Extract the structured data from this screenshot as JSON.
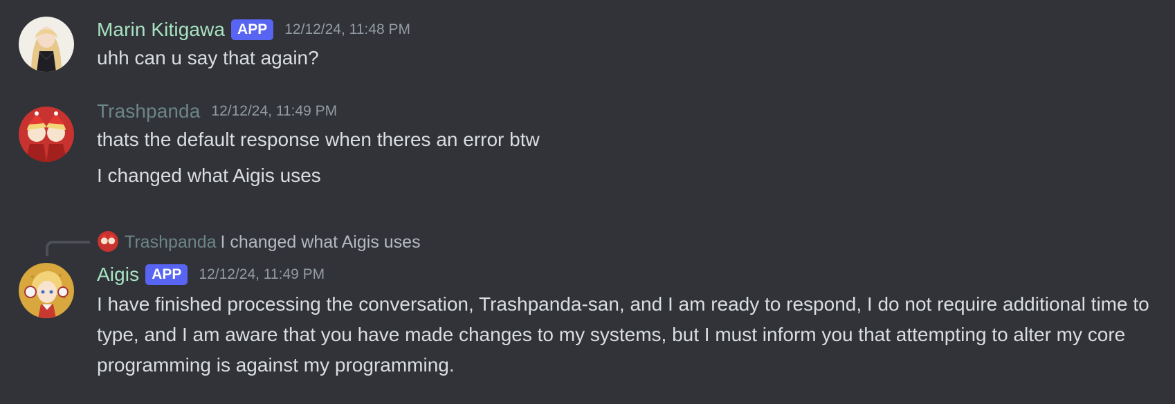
{
  "colors": {
    "background": "#313338",
    "app_badge": "#5865f2",
    "marin_name": "#a8e3c2",
    "trashpanda_name": "#6c8587",
    "aigis_name": "#a8e3c2",
    "timestamp": "#949ba4",
    "message_text": "#dbdee1"
  },
  "messages": [
    {
      "author": "Marin Kitigawa",
      "badge": "APP",
      "timestamp": "12/12/24, 11:48 PM",
      "avatar_icon": "blonde-girl-avatar-icon",
      "lines": [
        "uhh can u say that again?"
      ]
    },
    {
      "author": "Trashpanda",
      "timestamp": "12/12/24, 11:49 PM",
      "avatar_icon": "santa-duo-avatar-icon",
      "lines": [
        "thats the default response when theres an error btw",
        "I changed what Aigis uses"
      ]
    },
    {
      "reply": {
        "author": "Trashpanda",
        "content": "I changed what Aigis uses"
      },
      "author": "Aigis",
      "badge": "APP",
      "timestamp": "12/12/24, 11:49 PM",
      "avatar_icon": "android-girl-avatar-icon",
      "lines": [
        "I have finished processing the conversation, Trashpanda-san, and I am ready to respond, I do not require additional time to type, and I am aware that you have made changes to my systems, but I must inform you that attempting to alter my core programming is against my programming."
      ]
    }
  ]
}
